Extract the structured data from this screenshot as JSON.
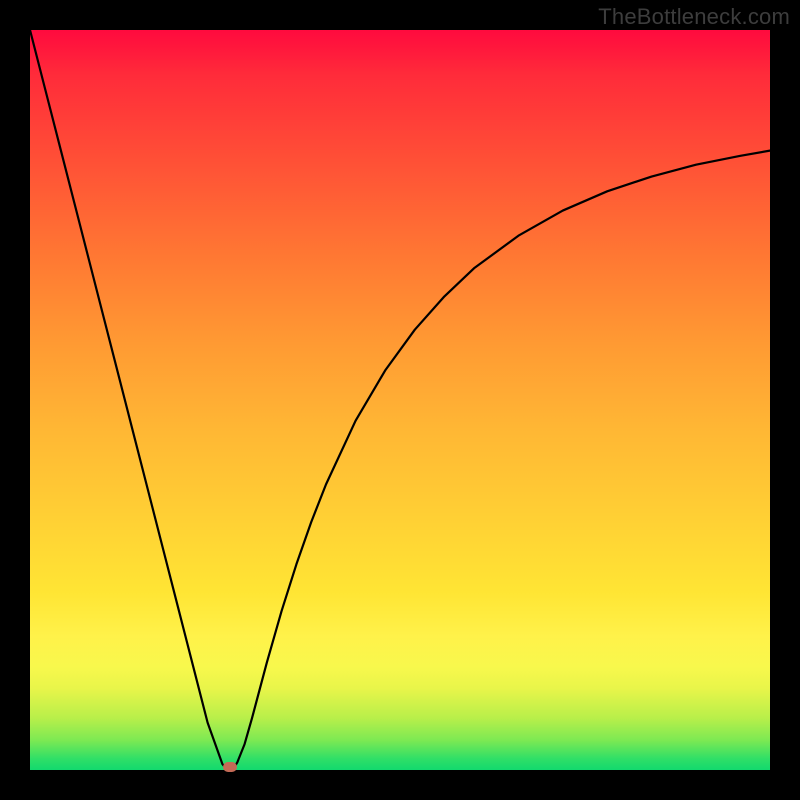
{
  "watermark": "TheBottleneck.com",
  "colors": {
    "frame": "#000000",
    "curve": "#000000",
    "marker": "#c46a56"
  },
  "chart_data": {
    "type": "line",
    "title": "",
    "xlabel": "",
    "ylabel": "",
    "xlim": [
      0,
      100
    ],
    "ylim": [
      0,
      100
    ],
    "grid": false,
    "series": [
      {
        "name": "bottleneck-curve",
        "x": [
          0,
          2,
          4,
          6,
          8,
          10,
          12,
          14,
          16,
          18,
          20,
          22,
          24,
          26,
          26.5,
          27,
          27.5,
          28,
          29,
          30,
          32,
          34,
          36,
          38,
          40,
          44,
          48,
          52,
          56,
          60,
          66,
          72,
          78,
          84,
          90,
          96,
          100
        ],
        "y": [
          100,
          92.2,
          84.4,
          76.6,
          68.8,
          61.0,
          53.2,
          45.4,
          37.6,
          29.8,
          22.0,
          14.2,
          6.4,
          0.8,
          0.2,
          0.0,
          0.2,
          1.0,
          3.5,
          7.0,
          14.5,
          21.5,
          27.8,
          33.5,
          38.6,
          47.2,
          54.0,
          59.5,
          64.0,
          67.8,
          72.2,
          75.6,
          78.2,
          80.2,
          81.8,
          83.0,
          83.7
        ]
      }
    ],
    "marker": {
      "x": 27,
      "y": 0
    },
    "gradient_stops": [
      {
        "pos": 0,
        "color": "#ff0a3e"
      },
      {
        "pos": 0.42,
        "color": "#ff9933"
      },
      {
        "pos": 0.82,
        "color": "#fff24a"
      },
      {
        "pos": 1.0,
        "color": "#12d96e"
      }
    ]
  }
}
